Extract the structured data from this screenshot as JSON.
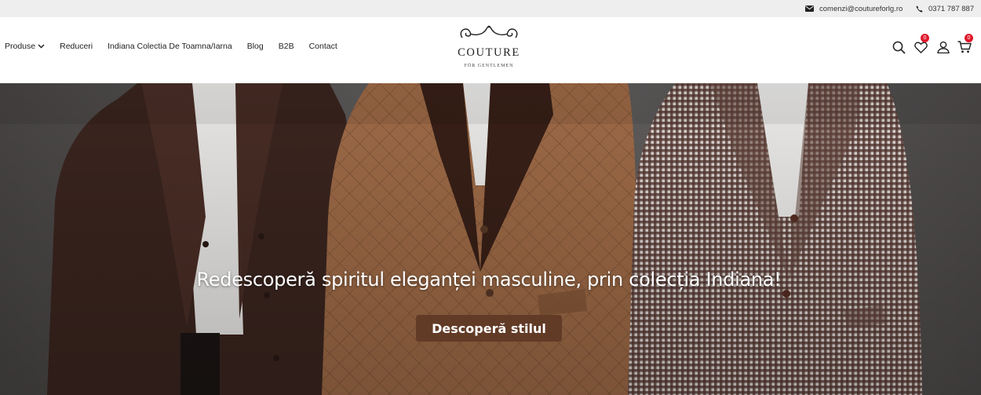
{
  "topbar": {
    "email": "comenzi@coutureforlg.ro",
    "phone": "0371 787 887"
  },
  "nav": {
    "items": [
      {
        "label": "Produse",
        "icon": "chevron-down-icon"
      },
      {
        "label": "Reduceri"
      },
      {
        "label": "Indiana Colectia De Toamna/Iarna"
      },
      {
        "label": "Blog"
      },
      {
        "label": "B2B"
      },
      {
        "label": "Contact"
      }
    ]
  },
  "logo": {
    "word": "COUTURE",
    "sub": "FÖR GENTLEMEN"
  },
  "header_icons": {
    "search": "search-icon",
    "wishlist": "heart-icon",
    "wishlist_count": "0",
    "account": "user-icon",
    "cart": "cart-icon",
    "cart_count": "0"
  },
  "hero": {
    "title": "Redescoperă spiritul eleganței masculine, prin colecția Indiana!",
    "cta": "Descoperă stilul"
  },
  "colors": {
    "topbar_bg": "#eeeeee",
    "badge": "#e0192b",
    "cta_bg": "#5f3826"
  }
}
